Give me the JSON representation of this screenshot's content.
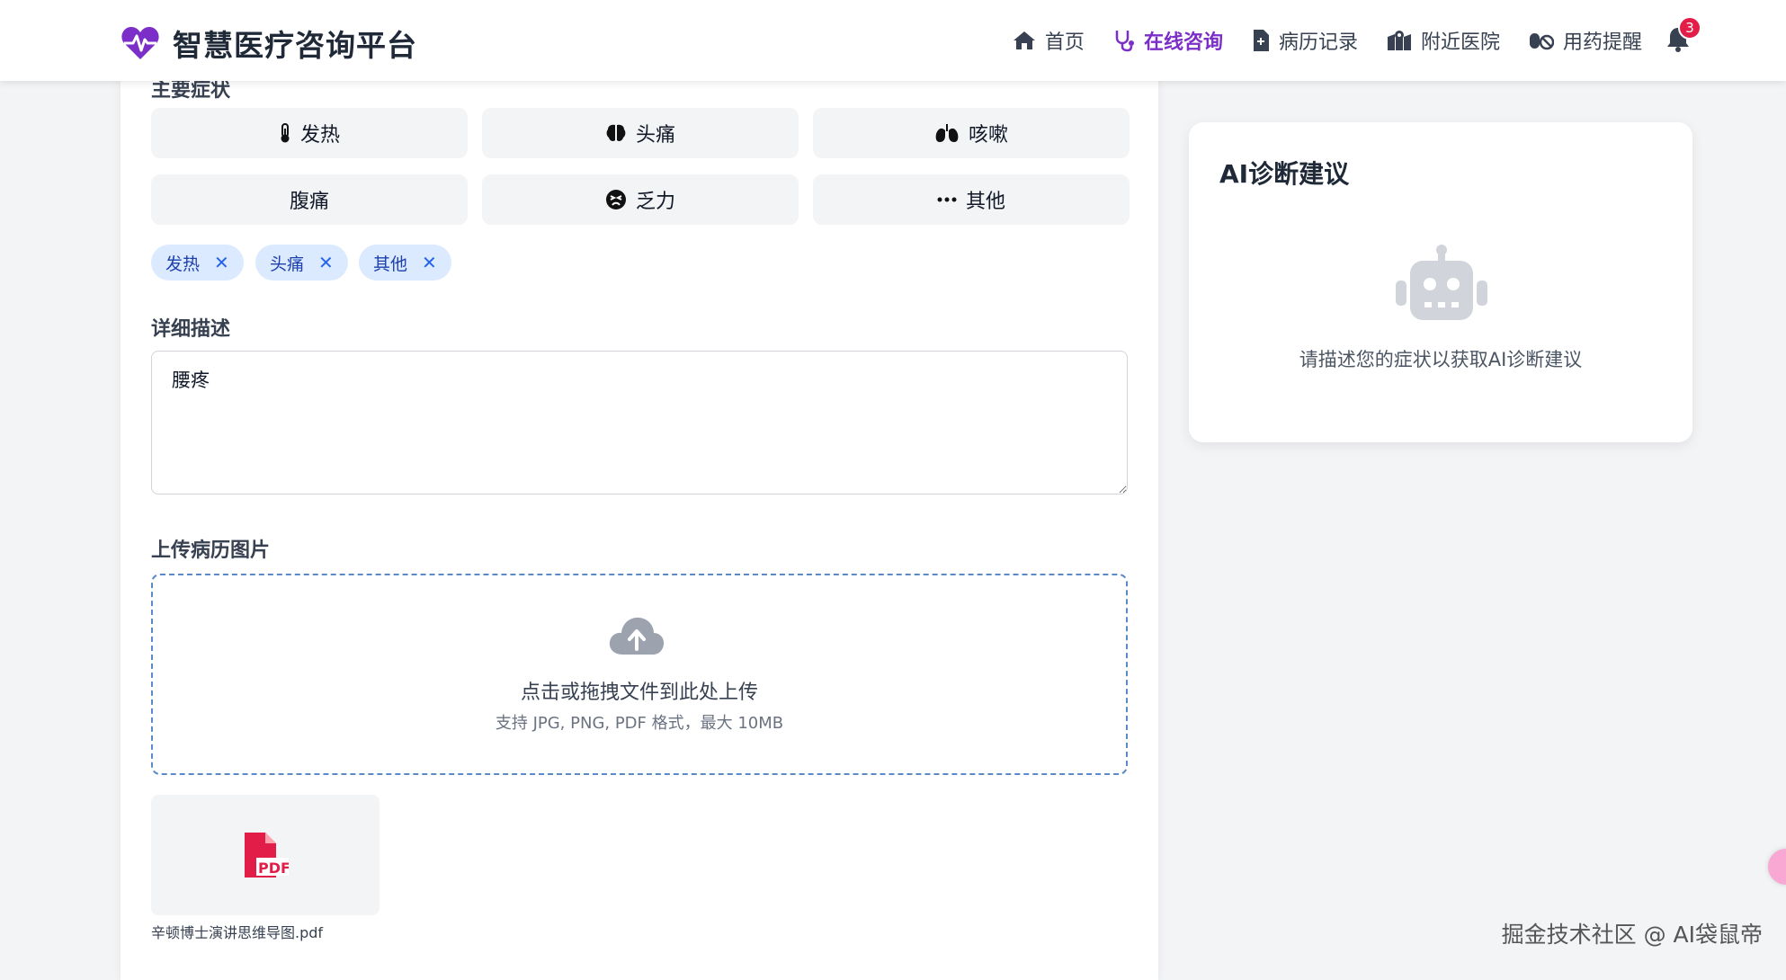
{
  "header": {
    "title": "智慧医疗咨询平台",
    "notification_count": "3",
    "nav": [
      {
        "label": "首页",
        "icon": "home-icon"
      },
      {
        "label": "在线咨询",
        "icon": "stethoscope-icon",
        "active": true
      },
      {
        "label": "病历记录",
        "icon": "medical-file-icon"
      },
      {
        "label": "附近医院",
        "icon": "map-icon"
      },
      {
        "label": "用药提醒",
        "icon": "pills-icon"
      }
    ]
  },
  "form": {
    "symptoms_label": "主要症状",
    "symptoms": [
      {
        "label": "发热",
        "icon": "thermometer-icon"
      },
      {
        "label": "头痛",
        "icon": "brain-icon"
      },
      {
        "label": "咳嗽",
        "icon": "lungs-icon"
      },
      {
        "label": "腹痛",
        "icon": ""
      },
      {
        "label": "乏力",
        "icon": "tired-face-icon"
      },
      {
        "label": "其他",
        "icon": "ellipsis-icon"
      }
    ],
    "selected_tags": [
      "发热",
      "头痛",
      "其他"
    ],
    "detail_label": "详细描述",
    "detail_value": "腰疼",
    "upload_label": "上传病历图片",
    "upload_main": "点击或拖拽文件到此处上传",
    "upload_sub": "支持 JPG, PNG, PDF 格式，最大 10MB",
    "uploaded_file": "辛顿博士演讲思维导图.pdf"
  },
  "ai": {
    "title": "AI诊断建议",
    "empty_text": "请描述您的症状以获取AI诊断建议"
  },
  "watermark": "掘金技术社区 @ AI袋鼠帝",
  "colors": {
    "accent": "#7c2ec9",
    "tag_bg": "#dbeafe",
    "tag_text": "#1e40af",
    "pdf_red": "#e11d48",
    "badge": "#e11d48",
    "upload_border": "#5b8ac8"
  }
}
